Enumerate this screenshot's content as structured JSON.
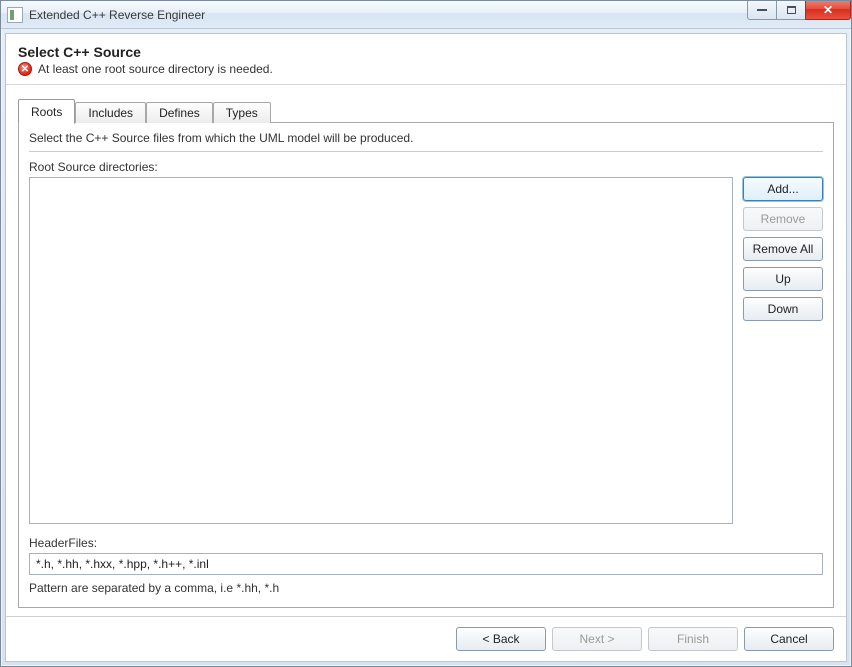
{
  "window": {
    "title": "Extended C++ Reverse Engineer"
  },
  "header": {
    "title": "Select C++ Source",
    "error": "At least one root source directory is needed."
  },
  "tabs": {
    "items": [
      "Roots",
      "Includes",
      "Defines",
      "Types"
    ],
    "active_index": 0
  },
  "panel": {
    "description": "Select the C++ Source files from which the UML model will be produced.",
    "root_label": "Root Source directories:",
    "headerfiles_label": "HeaderFiles:",
    "headerfiles_value": "*.h, *.hh, *.hxx, *.hpp, *.h++, *.inl",
    "pattern_hint": "Pattern are separated by a comma, i.e *.hh, *.h"
  },
  "side_buttons": {
    "add": "Add...",
    "remove": "Remove",
    "remove_all": "Remove All",
    "up": "Up",
    "down": "Down"
  },
  "footer": {
    "back": "< Back",
    "next": "Next >",
    "finish": "Finish",
    "cancel": "Cancel"
  }
}
